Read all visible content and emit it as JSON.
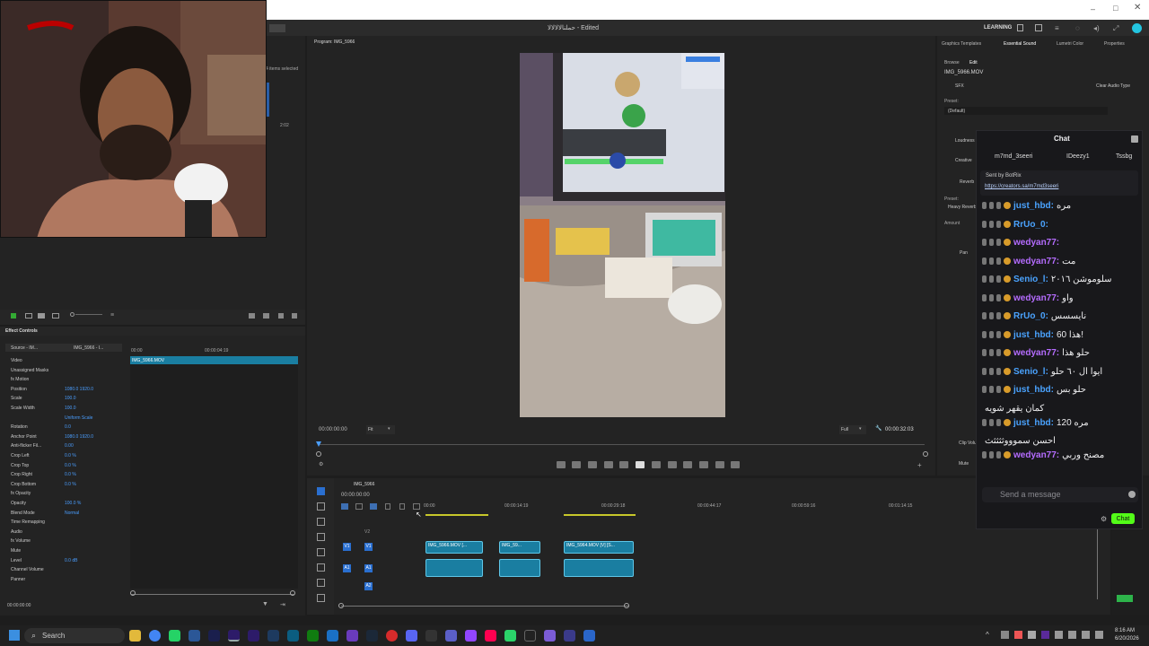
{
  "window": {
    "title": "حملنالالالالا - Edited",
    "workspace": "LEARNING"
  },
  "source_panel": {
    "items_selected": "4 items selected",
    "duration": "2:02"
  },
  "program": {
    "title": "Program: IMG_5966",
    "timecode_in": "00:00:00:00",
    "fit": "Fit",
    "quality": "Full",
    "timecode_out": "00:00:32:03"
  },
  "effect_controls": {
    "title": "Effect Controls",
    "source": "Source - IM...",
    "clip": "IMG_5966 - I...",
    "time_start": "00:00",
    "time_end": "00:00:04:19",
    "clip_label": "IMG_5966.MOV",
    "rows": [
      {
        "label": "Video",
        "value": ""
      },
      {
        "label": "Unassigned Masks",
        "value": ""
      },
      {
        "label": "fx Motion",
        "value": ""
      },
      {
        "label": "Position",
        "value": "1080.0   1920.0"
      },
      {
        "label": "Scale",
        "value": "100.0"
      },
      {
        "label": "Scale Width",
        "value": "100.0"
      },
      {
        "label": "",
        "value": "Uniform Scale"
      },
      {
        "label": "Rotation",
        "value": "0.0"
      },
      {
        "label": "Anchor Point",
        "value": "1080.0   1920.0"
      },
      {
        "label": "Anti-flicker Fil...",
        "value": "0.00"
      },
      {
        "label": "Crop Left",
        "value": "0.0 %"
      },
      {
        "label": "Crop Top",
        "value": "0.0 %"
      },
      {
        "label": "Crop Right",
        "value": "0.0 %"
      },
      {
        "label": "Crop Bottom",
        "value": "0.0 %"
      },
      {
        "label": "fx Opacity",
        "value": ""
      },
      {
        "label": "Opacity",
        "value": "100.0 %"
      },
      {
        "label": "Blend Mode",
        "value": "Normal"
      },
      {
        "label": "Time Remapping",
        "value": ""
      },
      {
        "label": "Audio",
        "value": ""
      },
      {
        "label": "fx Volume",
        "value": ""
      },
      {
        "label": "Mute",
        "value": ""
      },
      {
        "label": "Level",
        "value": "0.0 dB"
      },
      {
        "label": "Channel Volume",
        "value": ""
      },
      {
        "label": "Panner",
        "value": ""
      }
    ],
    "footer_time": "00:00:00:00"
  },
  "timeline": {
    "sequence": "IMG_5966",
    "timecode": "00:00:00:00",
    "ruler": [
      "00:00",
      "00:00:14:19",
      "00:00:29:18",
      "00:00:44:17",
      "00:00:59:16",
      "00:01:14:15"
    ],
    "tracks": [
      "V2",
      "V1",
      "A1",
      "A2"
    ],
    "clips": [
      "IMG_5966.MOV [...",
      "IMG_59...",
      "IMG_5964.MOV [V] [S..."
    ]
  },
  "essential_sound": {
    "tabs": [
      "Graphics Templates",
      "Essential Sound",
      "Lumetri Color",
      "Properties"
    ],
    "subtabs": [
      "Browse",
      "Edit"
    ],
    "clip": "IMG_5966.MOV",
    "type": "SFX",
    "clear": "Clear Audio Type",
    "preset_label": "Preset:",
    "preset_value": "(Default)",
    "sections": [
      "Loudness",
      "Creative",
      "Reverb",
      "Preset:",
      "Heavy Reverb",
      "Amount",
      "Pan",
      "Clip Volume",
      "Mute"
    ]
  },
  "chat": {
    "title": "Chat",
    "top_users": [
      "m7md_3seeri",
      "IDeezy1",
      "Tssbg"
    ],
    "pinned_by": "Sent by  BotRix",
    "pinned_link": "https://creators.sa/m7md3seeri",
    "messages": [
      {
        "user": "just_hbd:",
        "text": "مره",
        "color": "#4aa3ff"
      },
      {
        "user": "RrUo_0:",
        "text": "",
        "color": "#4aa3ff"
      },
      {
        "user": "wedyan77:",
        "text": "",
        "color": "#b56cff"
      },
      {
        "user": "wedyan77:",
        "text": "مت",
        "color": "#b56cff"
      },
      {
        "user": "Senio_l:",
        "text": "سلوموشن ٢٠١٦",
        "color": "#4aa3ff"
      },
      {
        "user": "wedyan77:",
        "text": "واو",
        "color": "#b56cff"
      },
      {
        "user": "RrUo_0:",
        "text": "نايسسس",
        "color": "#4aa3ff"
      },
      {
        "user": "just_hbd:",
        "text": "هذا 60!",
        "color": "#4aa3ff"
      },
      {
        "user": "wedyan77:",
        "text": "حلو هذا",
        "color": "#b56cff"
      },
      {
        "user": "Senio_l:",
        "text": "ايوا ال ٦٠ حلو",
        "color": "#4aa3ff"
      },
      {
        "user": "just_hbd:",
        "text": "حلو بس",
        "color": "#4aa3ff"
      },
      {
        "user": "",
        "text": "كمان يقهر شويه",
        "color": "#efeff1"
      },
      {
        "user": "just_hbd:",
        "text": "مره 120",
        "color": "#4aa3ff"
      },
      {
        "user": "",
        "text": "احسن سموووثثثثث",
        "color": "#efeff1"
      },
      {
        "user": "wedyan77:",
        "text": "مصنح وربي",
        "color": "#b56cff"
      }
    ],
    "placeholder": "Send a message",
    "send_label": "Chat"
  },
  "taskbar": {
    "search": "Search",
    "time": "8:16 AM",
    "date": "6/20/2026"
  },
  "colors": {
    "accent": "#4a9eff",
    "chat_green": "#53fc18",
    "clip": "#1a7ea1"
  }
}
